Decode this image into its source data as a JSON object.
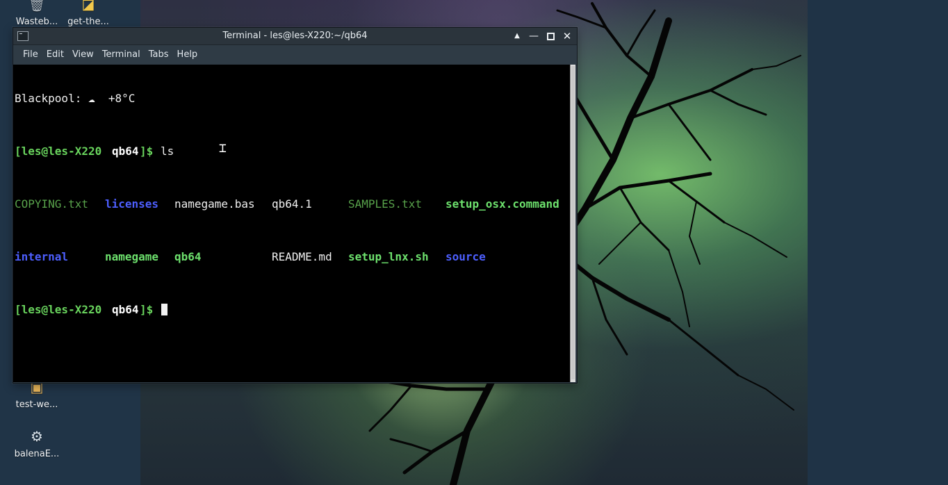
{
  "desktop": {
    "icons": [
      {
        "label": "Wasteb...",
        "icon": "trash-icon"
      },
      {
        "label": "get-the...",
        "icon": "python-script-icon"
      },
      {
        "label": "test-we...",
        "icon": "script-file-icon"
      },
      {
        "label": "balenaE...",
        "icon": "gear-app-icon"
      }
    ]
  },
  "terminal": {
    "title": "Terminal - les@les-X220:~/qb64",
    "controls": {
      "shade": "▲",
      "minimize": "—",
      "close": "✕"
    },
    "menu": [
      "File",
      "Edit",
      "View",
      "Terminal",
      "Tabs",
      "Help"
    ],
    "lines": {
      "weather": "Blackpool: ☁  +8°C",
      "prompt_user": "[les@les-X220",
      "prompt_dir": "qb64",
      "prompt_suffix": "]$",
      "command": "ls",
      "ls_row1": [
        "COPYING.txt",
        "licenses",
        "namegame.bas",
        "qb64.1",
        "SAMPLES.txt",
        "setup_osx.command"
      ],
      "ls_row2": [
        "internal",
        "namegame",
        "qb64",
        "README.md",
        "setup_lnx.sh",
        "source"
      ]
    },
    "colors": {
      "prompt_green": "#69d45d",
      "dir_blue": "#4d5fff",
      "exec_green": "#6de16d",
      "txt_green": "#58a24b"
    }
  }
}
